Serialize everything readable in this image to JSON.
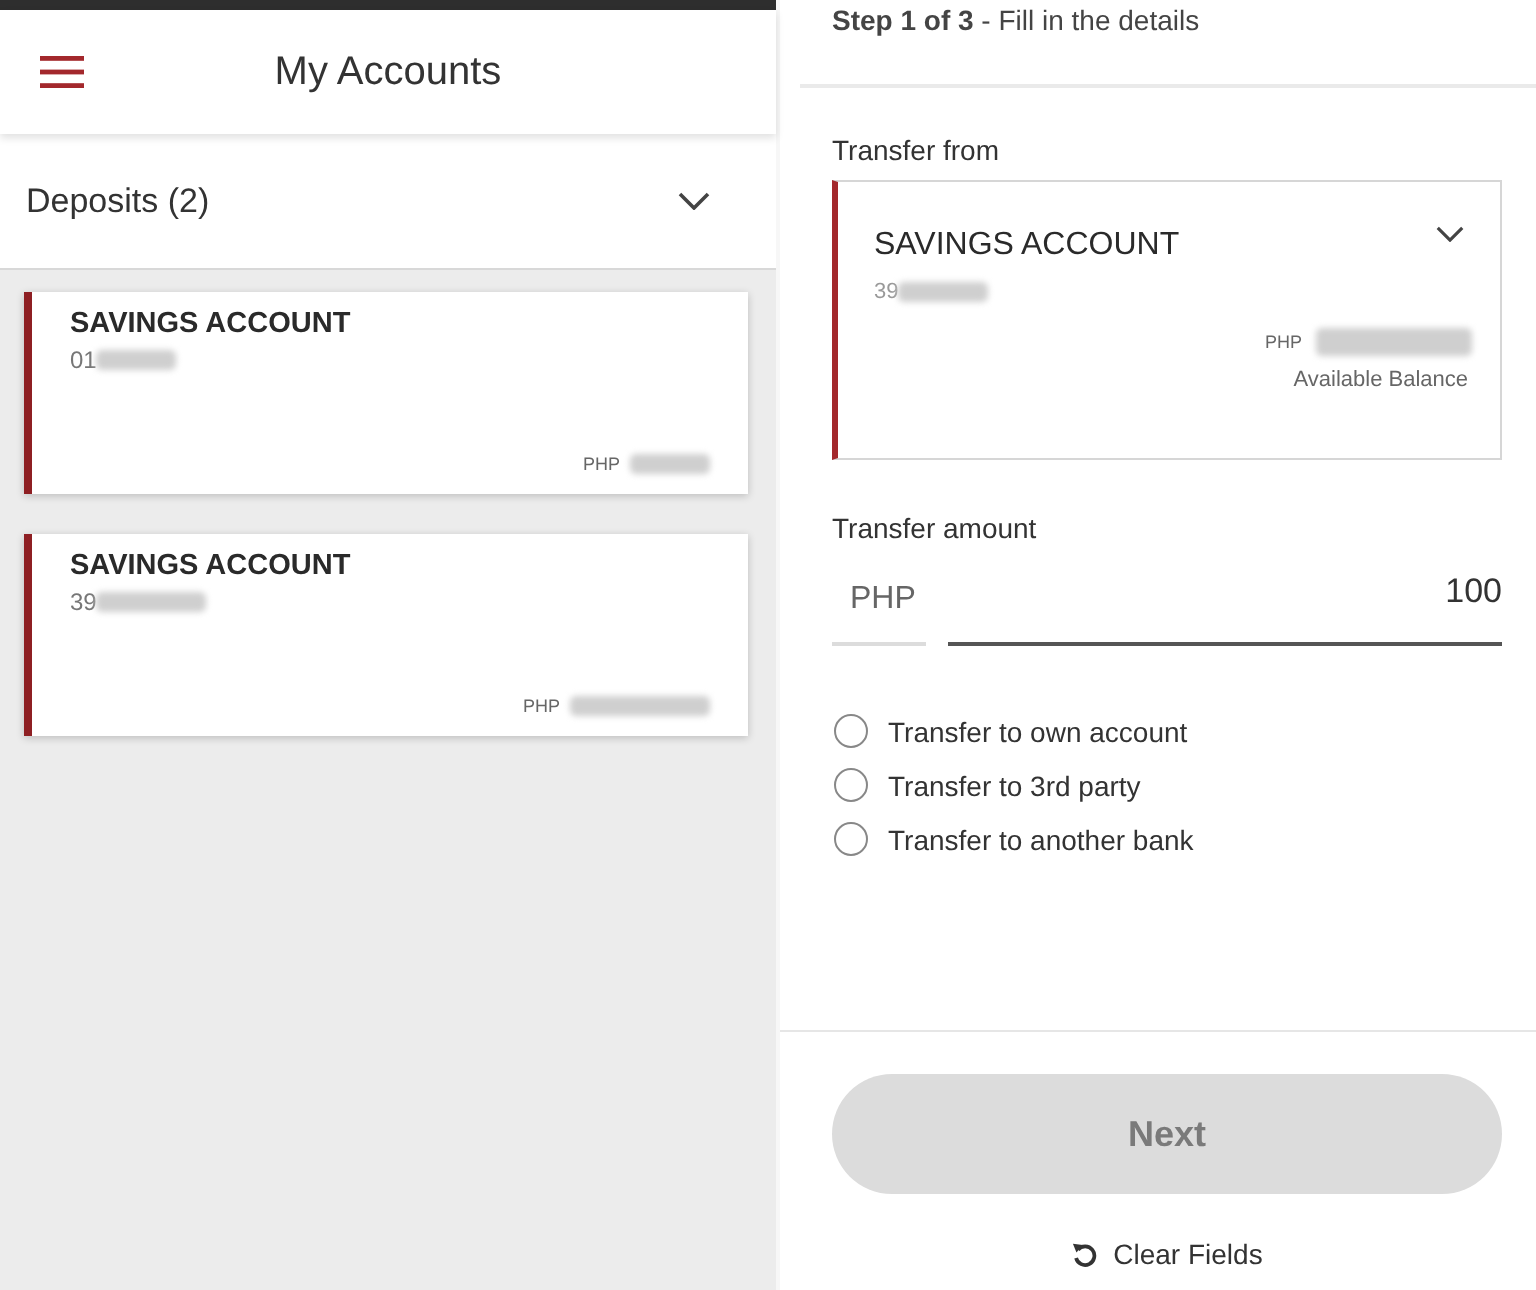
{
  "accounts_screen": {
    "title": "My Accounts",
    "section": {
      "label": "Deposits (2)"
    },
    "accounts": [
      {
        "name": "SAVINGS ACCOUNT",
        "number": "01",
        "masked": true,
        "currency": "PHP"
      },
      {
        "name": "SAVINGS ACCOUNT",
        "number": "39",
        "masked": true,
        "currency": "PHP"
      }
    ]
  },
  "transfer_screen": {
    "step": "**Step 1 of 3** - Fill in the details",
    "from": {
      "label": "Transfer from",
      "account": {
        "name": "SAVINGS ACCOUNT",
        "number": "39",
        "masked": true,
        "currency": "PHP",
        "balance_label": "Available Balance"
      }
    },
    "amount": {
      "label": "Transfer amount",
      "currency": "PHP",
      "value": "100"
    },
    "transfer_types": [
      {
        "label": "Transfer to own account",
        "selected": false
      },
      {
        "label": "Transfer to 3rd party",
        "selected": false
      },
      {
        "label": "Transfer to another bank",
        "selected": false
      }
    ],
    "next_button": {
      "label": "Next",
      "disabled": true
    },
    "clear_button": {
      "label": "Clear Fields"
    }
  }
}
